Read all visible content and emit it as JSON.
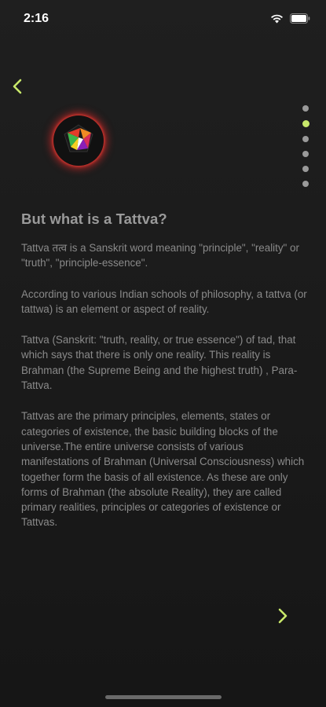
{
  "status_bar": {
    "time": "2:16",
    "icons": [
      "location-arrow-icon",
      "wifi-icon",
      "battery-icon"
    ]
  },
  "navigation": {
    "back_icon": "chevron-left-icon",
    "next_icon": "chevron-right-icon",
    "accent_color": "#c8e86a"
  },
  "pagination": {
    "total": 6,
    "current": 2
  },
  "logo": {
    "icon": "tattva-logo-icon"
  },
  "article": {
    "title": "But what is a Tattva?",
    "paragraphs": [
      "Tattva तत्व is a Sanskrit word meaning \"principle\", \"reality\" or \"truth\", \"principle-essence\".",
      "According to various Indian schools of philosophy, a tattva (or tattwa) is an element or aspect of reality.",
      "Tattva (Sanskrit: \"truth, reality, or true essence\") of tad, that which says that there is only one reality. This reality is Brahman (the Supreme Being and the highest truth) , Para-Tattva.",
      "Tattvas are the primary principles, elements, states or categories of existence, the basic building blocks of the universe.The entire universe consists of various manifestations of Brahman (Universal Consciousness) which together form the basis of all existence. As these are only forms of Brahman (the absolute Reality), they are called primary realities, principles or categories of existence or Tattvas."
    ]
  }
}
